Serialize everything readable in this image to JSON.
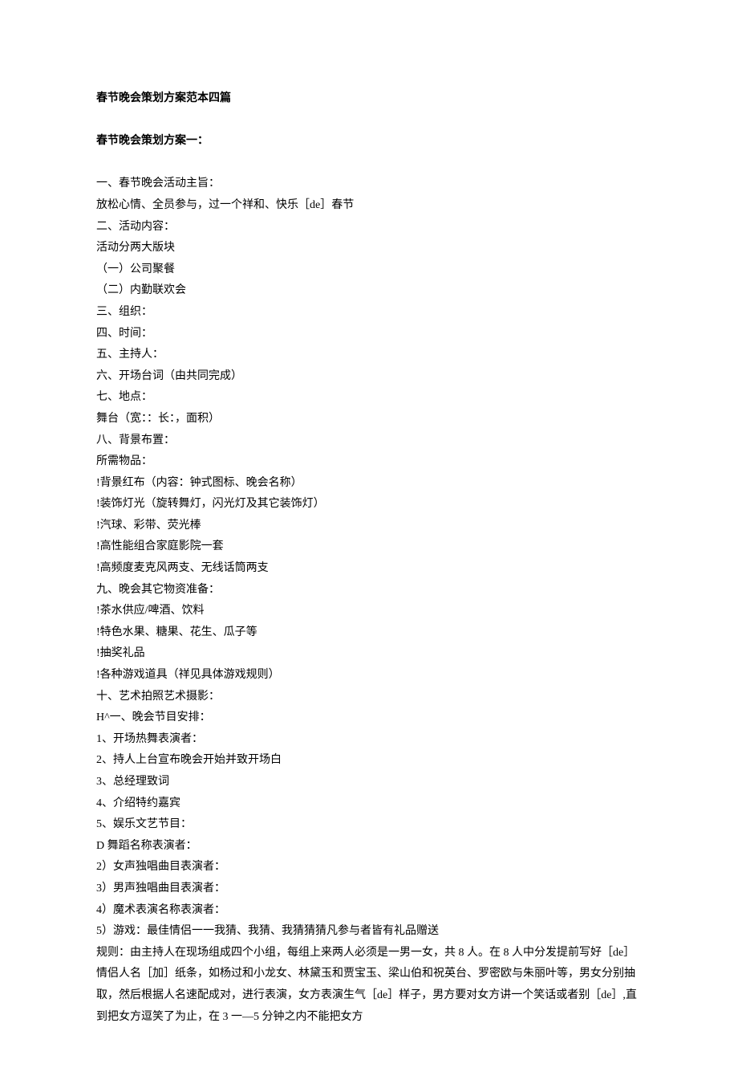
{
  "title": "春节晚会策划方案范本四篇",
  "subtitle": "春节晚会策划方案一：",
  "lines": [
    "一、春节晚会活动主旨：",
    "放松心情、全员参与，过一个祥和、快乐［de］春节",
    "二、活动内容：",
    "活动分两大版块",
    "（一）公司聚餐",
    "（二）内勤联欢会",
    "三、组织：",
    "四、时间：",
    "五、主持人：",
    "六、开场台词（由共同完成）",
    "七、地点：",
    "舞台（宽：：长：，面积）",
    "八、背景布置：",
    "所需物品：",
    "!背景红布（内容：钟式图标、晚会名称）",
    "!装饰灯光（旋转舞灯，闪光灯及其它装饰灯）",
    "!汽球、彩带、荧光棒",
    "!高性能组合家庭影院一套",
    "!高频度麦克风两支、无线话筒两支",
    "九、晚会其它物资准备：",
    "!茶水供应/啤酒、饮料",
    "!特色水果、糖果、花生、瓜子等",
    "!抽奖礼品",
    "!各种游戏道具（祥见具体游戏规则）",
    "十、艺术拍照艺术摄影：",
    "H^一、晚会节目安排：",
    "1、开场热舞表演者：",
    "2、持人上台宣布晚会开始并致开场白",
    "3、总经理致词",
    "4、介绍特约嘉宾",
    "5、娱乐文艺节目：",
    "D 舞蹈名称表演者：",
    "2）女声独唱曲目表演者：",
    "3）男声独唱曲目表演者：",
    "4）魔术表演名称表演者：",
    "5）游戏：最佳情侣一一我猜、我猜、我猜猜猜凡参与者皆有礼品赠送",
    "规则：由主持人在现场组成四个小组，每组上来两人必须是一男一女，共 8 人。在 8 人中分发提前写好［de］情侣人名［加］纸条，如杨过和小龙女、林黛玉和贾宝玉、梁山伯和祝英台、罗密欧与朱丽叶等，男女分别抽取，然后根据人名速配成对，进行表演，女方表演生气［de］样子，男方要对女方讲一个笑话或者别［de］,直到把女方逗笑了为止，在 3 一—5 分钟之内不能把女方"
  ]
}
